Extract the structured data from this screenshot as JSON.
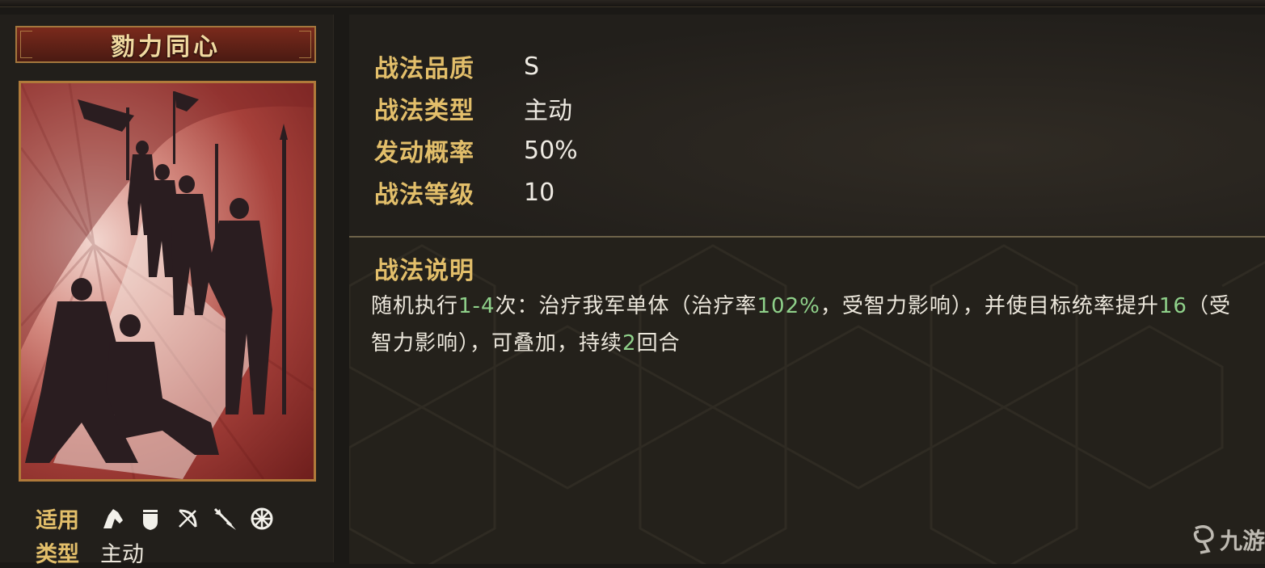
{
  "skill": {
    "name": "勠力同心",
    "stats": [
      {
        "label": "战法品质",
        "value": "S"
      },
      {
        "label": "战法类型",
        "value": "主动"
      },
      {
        "label": "发动概率",
        "value": "50%"
      },
      {
        "label": "战法等级",
        "value": "10"
      }
    ],
    "description": {
      "title": "战法说明",
      "segments": [
        {
          "text": "随机执行",
          "highlight": false
        },
        {
          "text": "1-4",
          "highlight": true
        },
        {
          "text": "次：治疗我军单体（治疗率",
          "highlight": false
        },
        {
          "text": "102%",
          "highlight": true
        },
        {
          "text": "，受智力影响），并使目标统率提升",
          "highlight": false
        },
        {
          "text": "16",
          "highlight": true
        },
        {
          "text": "（受智力影响），可叠加，持续",
          "highlight": false
        },
        {
          "text": "2",
          "highlight": true
        },
        {
          "text": "回合",
          "highlight": false
        }
      ]
    },
    "apply_label": "适用",
    "apply_icons": [
      "cavalry-icon",
      "shield-icon",
      "bow-icon",
      "spear-icon",
      "wheel-icon"
    ],
    "type_label": "类型",
    "type_value": "主动"
  },
  "colors": {
    "label_gold": "#e2be6a",
    "highlight_green": "#8fd18a",
    "text_light": "#ece7dc",
    "banner_red": "#7a2a1c",
    "frame_gold": "#b07a3a"
  },
  "watermark": {
    "text": "九游",
    "icon": "nine-game-logo-icon"
  }
}
